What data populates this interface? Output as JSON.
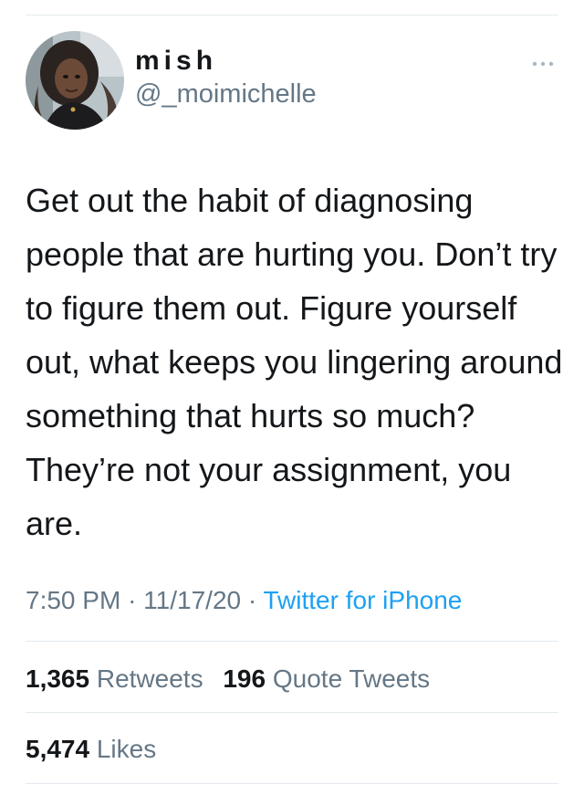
{
  "user": {
    "display_name": "mish",
    "handle": "@_moimichelle",
    "avatar_icon": "profile-photo",
    "more_icon": "more-horizontal-icon"
  },
  "tweet": {
    "text": "Get out the habit of diagnosing people that are hurting you. Don’t try to figure them out. Figure yourself out, what keeps you lingering around something that hurts so much? They’re not your assignment, you are.",
    "time": "7:50 PM",
    "date": "11/17/20",
    "separator": "·",
    "source": "Twitter for iPhone"
  },
  "stats": {
    "retweets_count": "1,365",
    "retweets_label": "Retweets",
    "quotes_count": "196",
    "quotes_label": "Quote Tweets",
    "likes_count": "5,474",
    "likes_label": "Likes"
  },
  "colors": {
    "text": "#14171a",
    "muted": "#657786",
    "link": "#1da1f2",
    "divider": "#e1e8ed"
  }
}
